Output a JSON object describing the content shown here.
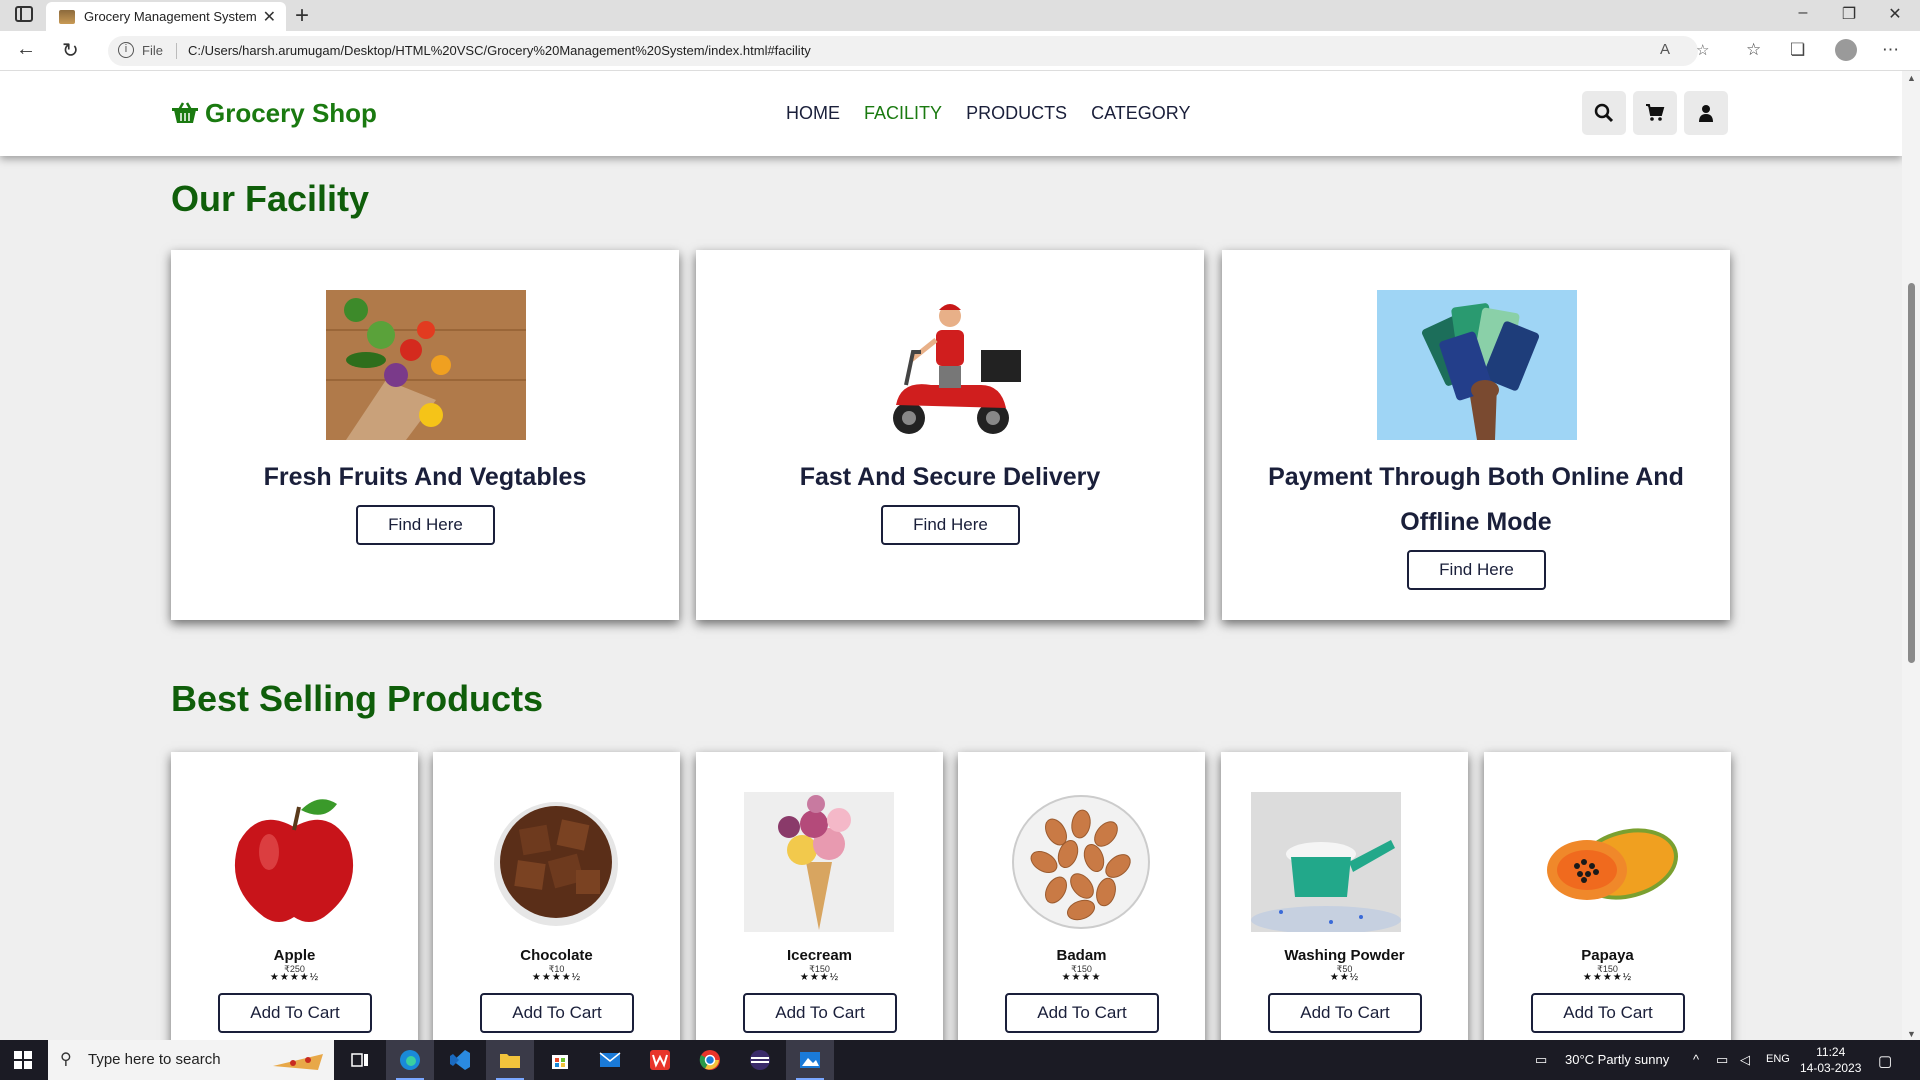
{
  "browser": {
    "tab_title": "Grocery Management System",
    "file_label": "File",
    "url": "C:/Users/harsh.arumugam/Desktop/HTML%20VSC/Grocery%20Management%20System/index.html#facility"
  },
  "site": {
    "logo_text": "Grocery Shop",
    "nav": [
      {
        "label": "HOME"
      },
      {
        "label": "FACILITY"
      },
      {
        "label": "PRODUCTS"
      },
      {
        "label": "CATEGORY"
      }
    ]
  },
  "facility": {
    "title": "Our Facility",
    "cards": [
      {
        "title": "Fresh Fruits And Vegtables",
        "button": "Find Here"
      },
      {
        "title": "Fast And Secure Delivery",
        "button": "Find Here"
      },
      {
        "title": "Payment Through Both Online And Offline Mode",
        "button": "Find Here"
      }
    ]
  },
  "products": {
    "title": "Best Selling Products",
    "items": [
      {
        "name": "Apple",
        "price": "₹250",
        "stars": "★★★★½",
        "button": "Add To Cart"
      },
      {
        "name": "Chocolate",
        "price": "₹10",
        "stars": "★★★★½",
        "button": "Add To Cart"
      },
      {
        "name": "Icecream",
        "price": "₹150",
        "stars": "★★★½",
        "button": "Add To Cart"
      },
      {
        "name": "Badam",
        "price": "₹150",
        "stars": "★★★★",
        "button": "Add To Cart"
      },
      {
        "name": "Washing Powder",
        "price": "₹50",
        "stars": "★★½",
        "button": "Add To Cart"
      },
      {
        "name": "Papaya",
        "price": "₹150",
        "stars": "★★★★½",
        "button": "Add To Cart"
      }
    ]
  },
  "taskbar": {
    "search_placeholder": "Type here to search",
    "weather": "30°C  Partly sunny",
    "lang": "ENG",
    "time": "11:24",
    "date": "14-03-2023"
  }
}
